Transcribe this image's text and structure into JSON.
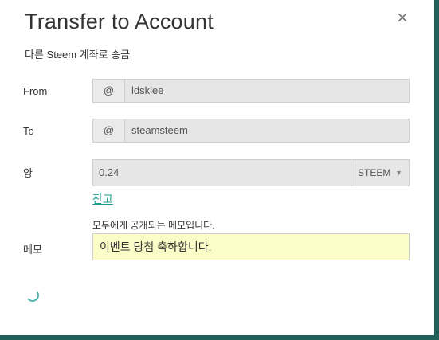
{
  "dialog": {
    "title": "Transfer to Account",
    "subtitle": "다른 Steem 계좌로 송금",
    "close_icon": "×"
  },
  "form": {
    "from": {
      "label": "From",
      "prefix": "@",
      "value": "ldsklee"
    },
    "to": {
      "label": "To",
      "prefix": "@",
      "value": "steamsteem"
    },
    "amount": {
      "label": "양",
      "value": "0.24",
      "asset": "STEEM",
      "balance_link": "잔고"
    },
    "memo": {
      "label": "메모",
      "hint": "모두에게 공개되는 메모입니다.",
      "value": "이벤트 당첨 축하합니다."
    }
  },
  "colors": {
    "accent": "#1a9c8c",
    "frame": "#1f5f57",
    "memo_bg": "#fbfcc7",
    "spinner": "#4bb6ad"
  }
}
